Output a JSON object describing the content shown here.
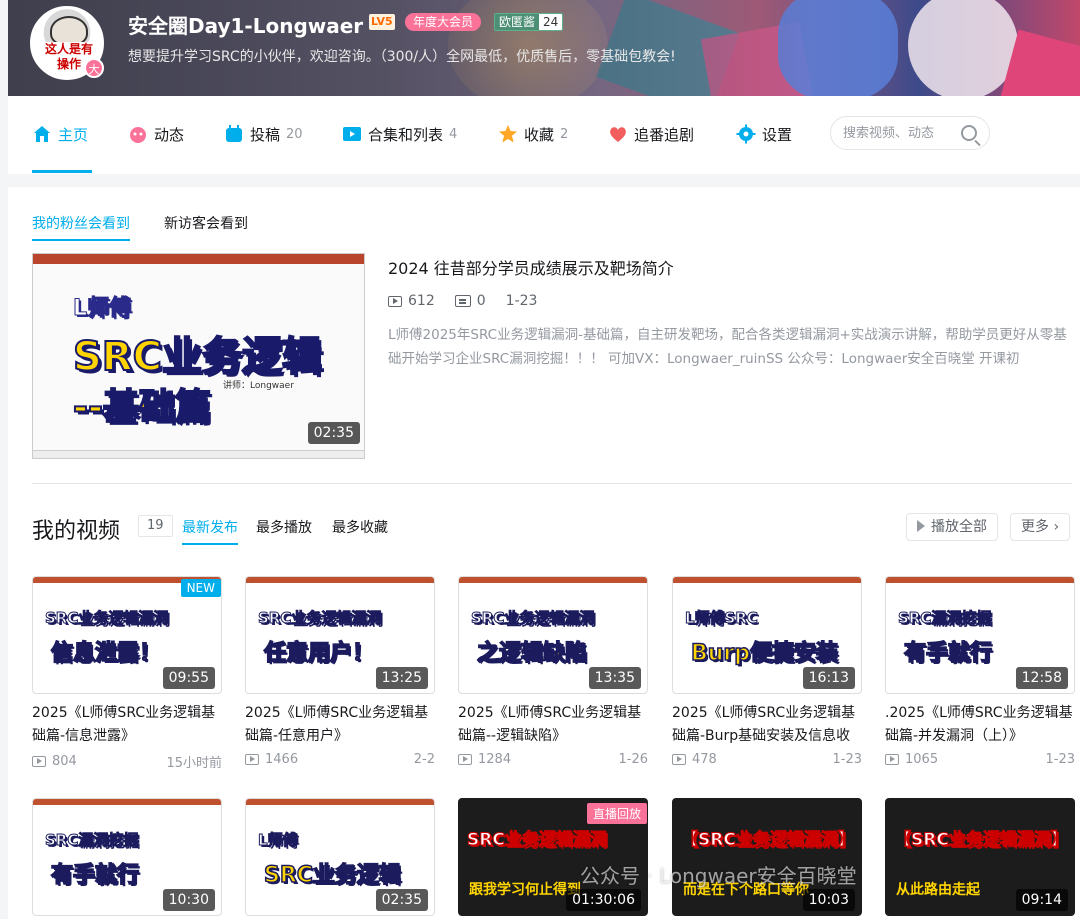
{
  "profile": {
    "name": "安全圈Day1-Longwaer",
    "level": "LV5",
    "vip": "年度大会员",
    "medal_name": "欧匿酱",
    "medal_level": "24",
    "sign": "想要提升学习SRC的小伙伴，欢迎咨询。（300/人）全网最低，优质售后，零基础包教会!",
    "avatar_text_1": "这人是有",
    "avatar_text_2": "操作",
    "avatar_badge": "大"
  },
  "nav": {
    "items": [
      {
        "label": "主页",
        "icon": "home-icon",
        "count": ""
      },
      {
        "label": "动态",
        "icon": "dynamic-icon",
        "count": ""
      },
      {
        "label": "投稿",
        "icon": "upload-icon",
        "count": "20"
      },
      {
        "label": "合集和列表",
        "icon": "collection-icon",
        "count": "4"
      },
      {
        "label": "收藏",
        "icon": "star-icon",
        "count": "2"
      },
      {
        "label": "追番追剧",
        "icon": "heart-icon",
        "count": ""
      },
      {
        "label": "设置",
        "icon": "gear-icon",
        "count": ""
      }
    ],
    "search_placeholder": "搜索视频、动态"
  },
  "subtabs": [
    "我的粉丝会看到",
    "新访客会看到"
  ],
  "featured": {
    "title": "2024 往昔部分学员成绩展示及靶场简介",
    "views": "612",
    "danmaku": "0",
    "date": "1-23",
    "duration": "02:35",
    "desc": "L师傅2025年SRC业务逻辑漏洞-基础篇，自主研发靶场，配合各类逻辑漏洞+实战演示讲解，帮助学员更好从零基础开始学习企业SRC漏洞挖掘！！！ 可加VX：Longwaer_ruinSS 公众号：Longwaer安全百晓堂 开课初",
    "thumb_line1": "L师傅",
    "thumb_line2": "SRC业务逻辑",
    "thumb_line3": "--基础篇",
    "thumb_sub": "讲师：Longwaer"
  },
  "videos_section": {
    "title": "我的视频",
    "count": "19",
    "sorts": [
      "最新发布",
      "最多播放",
      "最多收藏"
    ],
    "play_all": "播放全部",
    "more": "更多"
  },
  "videos": [
    {
      "title": "2025《L师傅SRC业务逻辑基础篇-信息泄露》",
      "views": "804",
      "date": "15小时前",
      "duration": "09:55",
      "badge": "NEW",
      "l1": "SRC业务逻辑漏洞",
      "l2": "信息泄露！"
    },
    {
      "title": "2025《L师傅SRC业务逻辑基础篇-任意用户》",
      "views": "1466",
      "date": "2-2",
      "duration": "13:25",
      "badge": "",
      "l1": "SRC业务逻辑漏洞",
      "l2": "任意用户！"
    },
    {
      "title": "2025《L师傅SRC业务逻辑基础篇--逻辑缺陷》",
      "views": "1284",
      "date": "1-26",
      "duration": "13:35",
      "badge": "",
      "l1": "SRC业务逻辑漏洞",
      "l2": "之逻辑缺陷"
    },
    {
      "title": "2025《L师傅SRC业务逻辑基础篇-Burp基础安装及信息收",
      "views": "478",
      "date": "1-23",
      "duration": "16:13",
      "badge": "",
      "l1": "L师傅SRC",
      "l2": "Burp便捷安装"
    },
    {
      "title": ".2025《L师傅SRC业务逻辑基础篇-并发漏洞（上）》",
      "views": "1065",
      "date": "1-23",
      "duration": "12:58",
      "badge": "",
      "l1": "SRC漏洞挖掘",
      "l2": "有手就行"
    },
    {
      "title": "",
      "views": "",
      "date": "",
      "duration": "10:30",
      "badge": "",
      "l1": "SRC漏洞挖掘",
      "l2": "有手就行"
    },
    {
      "title": "",
      "views": "",
      "date": "",
      "duration": "02:35",
      "badge": "",
      "l1": "L师傅",
      "l2": "SRC业务逻辑"
    },
    {
      "title": "",
      "views": "",
      "date": "",
      "duration": "01:30:06",
      "badge": "直播回放",
      "l1": "SRC业务逻辑漏洞",
      "l2": "跟我学习何止得到"
    },
    {
      "title": "",
      "views": "",
      "date": "",
      "duration": "10:03",
      "badge": "",
      "l1": "【SRC业务逻辑漏洞】",
      "l2": "而是在下个路口等你"
    },
    {
      "title": "",
      "views": "",
      "date": "",
      "duration": "09:14",
      "badge": "",
      "l1": "【SRC业务逻辑漏洞】",
      "l2": "从此路由走起"
    }
  ],
  "watermark": "公众号 · Longwaer安全百晓堂"
}
